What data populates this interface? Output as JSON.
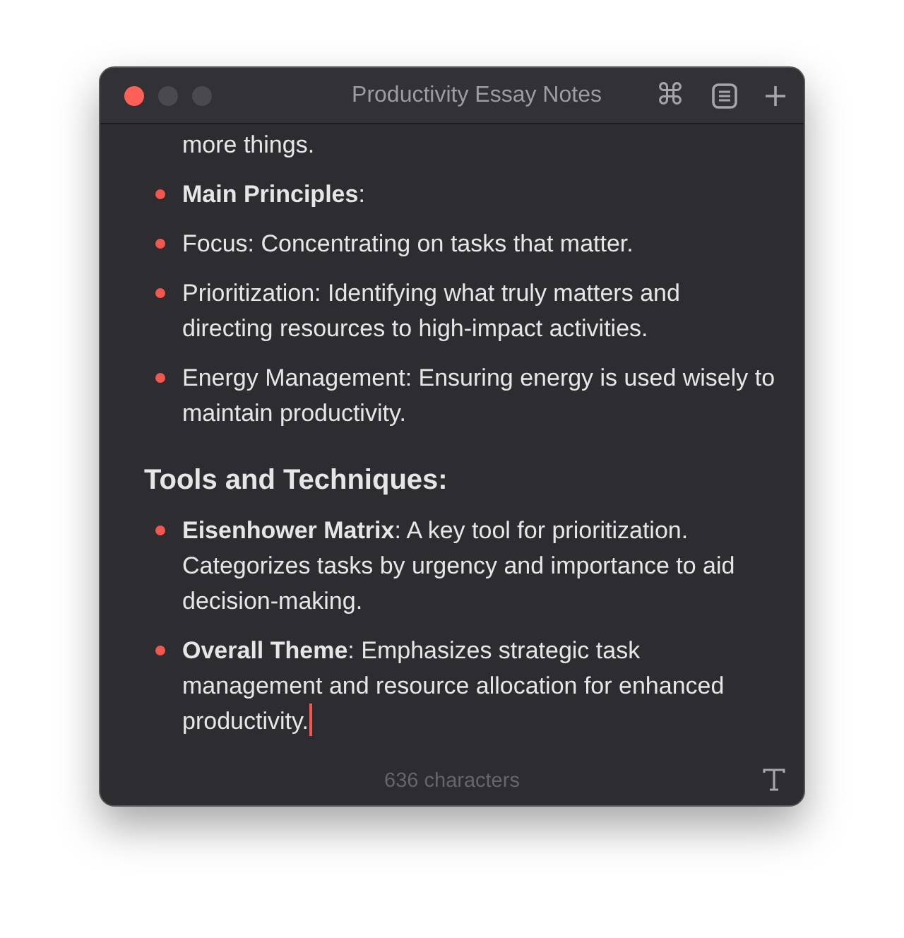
{
  "window": {
    "title": "Productivity Essay Notes",
    "toolbar": {
      "command_key": "⌘"
    }
  },
  "note": {
    "text_cursor": true,
    "blocks": [
      {
        "kind": "paragraph",
        "text": "more things."
      },
      {
        "kind": "bullet",
        "text": "**Main Principles**:"
      },
      {
        "kind": "bullet",
        "text": "Focus: Concentrating on tasks that matter."
      },
      {
        "kind": "bullet",
        "text": "Prioritization: Identifying what truly matters and directing resources to high-impact activities."
      },
      {
        "kind": "bullet",
        "text": "Energy Management: Ensuring energy is used wisely to maintain productivity."
      },
      {
        "kind": "heading",
        "text": "Tools and Techniques:"
      },
      {
        "kind": "bullet",
        "text": "**Eisenhower Matrix**: A key tool for prioritization. Categorizes tasks by urgency and importance to aid decision-making."
      },
      {
        "kind": "bullet",
        "text": "**Overall Theme**: Emphasizes strategic task management and resource allocation for enhanced productivity."
      }
    ]
  },
  "status_bar": {
    "character_count": "636 characters"
  }
}
